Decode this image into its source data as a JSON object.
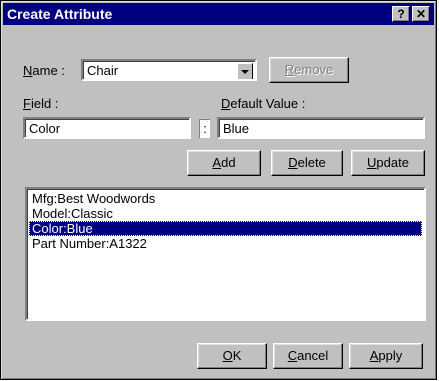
{
  "window": {
    "title": "Create Attribute",
    "help_label": "?",
    "close_label": "✕"
  },
  "name": {
    "label_mnemonic": "N",
    "label_rest": "ame :",
    "value": "Chair"
  },
  "remove_button": {
    "mnemonic": "R",
    "rest": "emove",
    "enabled": false
  },
  "field": {
    "label_mnemonic": "F",
    "label_rest": "ield :",
    "value": "Color",
    "separator": ":"
  },
  "default_value": {
    "label_mnemonic": "D",
    "label_rest": "efault Value :",
    "value": "Blue"
  },
  "buttons": {
    "add": {
      "mnemonic": "A",
      "rest": "dd"
    },
    "delete": {
      "mnemonic": "D",
      "rest": "elete"
    },
    "update": {
      "mnemonic": "U",
      "rest": "pdate"
    },
    "ok": {
      "mnemonic": "O",
      "rest": "K"
    },
    "cancel": {
      "mnemonic": "C",
      "rest": "ancel"
    },
    "apply": {
      "mnemonic": "A",
      "rest": "pply"
    }
  },
  "attributes": [
    "Mfg:Best Woodwords",
    "Model:Classic",
    "Color:Blue",
    "Part Number:A1322"
  ],
  "selected_attribute": "Color:Blue"
}
